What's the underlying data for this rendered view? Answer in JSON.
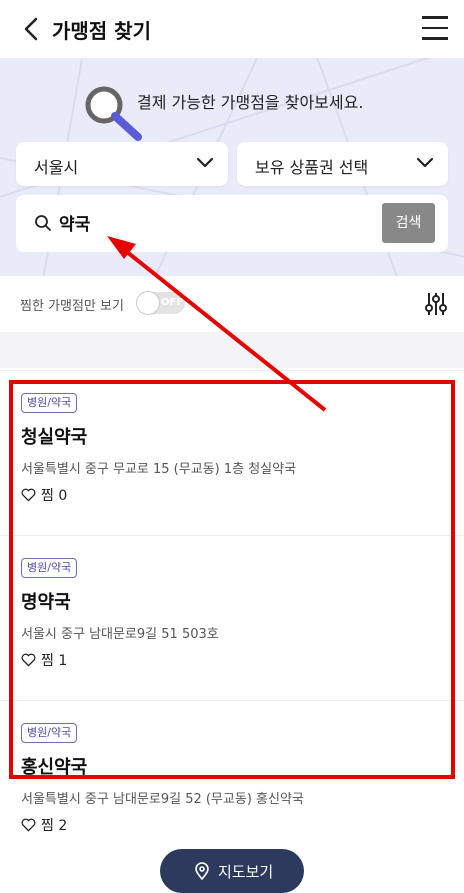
{
  "header": {
    "title": "가맹점 찾기"
  },
  "hero": {
    "message": "결제 가능한 가맹점을 찾아보세요.",
    "region_select": "서울시",
    "voucher_select": "보유 상품권 선택",
    "search_value": "약국",
    "search_button": "검색"
  },
  "filter": {
    "favorites_only_label": "찜한 가맹점만 보기",
    "toggle_state": "OFF"
  },
  "stores": [
    {
      "category": "병원/약국",
      "name": "청실약국",
      "address": "서울특별시 중구 무교로 15 (무교동) 1층 청실약국",
      "likes": "찜 0"
    },
    {
      "category": "병원/약국",
      "name": "명약국",
      "address": "서울시 중구 남대문로9길 51 503호",
      "likes": "찜 1"
    },
    {
      "category": "병원/약국",
      "name": "홍신약국",
      "address": "서울특별시 중구 남대문로9길 52 (무교동) 홍신약국",
      "likes": "찜 2"
    }
  ],
  "map_button": "지도보기",
  "colors": {
    "annotation_red": "#e60000",
    "map_button_bg": "#2d3a5e",
    "hero_bg": "#e9ebf8"
  }
}
